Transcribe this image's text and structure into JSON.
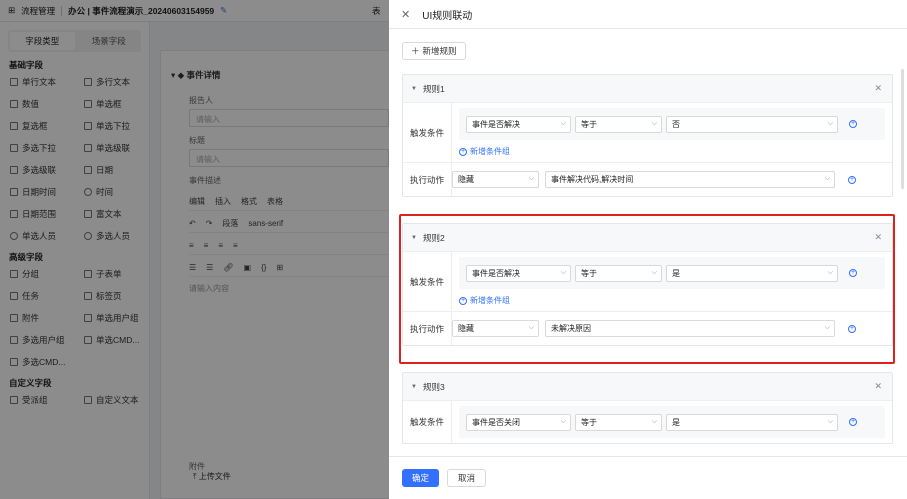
{
  "topbar": {
    "breadcrumb_root": "流程管理",
    "breadcrumb_current": "办公 | 事件流程演示_20240603154959",
    "right_label": "表"
  },
  "left_panel": {
    "tabs": [
      {
        "label": "字段类型"
      },
      {
        "label": "场景字段"
      }
    ],
    "sections": [
      {
        "title": "基础字段",
        "items": [
          "单行文本",
          "多行文本",
          "数值",
          "单选框",
          "复选框",
          "单选下拉",
          "多选下拉",
          "单选级联",
          "多选级联",
          "日期",
          "日期时间",
          "时间",
          "日期范围",
          "富文本",
          "单选人员",
          "多选人员"
        ]
      },
      {
        "title": "高级字段",
        "items": [
          "分组",
          "子表单",
          "任务",
          "标签页",
          "附件",
          "单选用户组",
          "多选用户组",
          "单选CMD...",
          "多选CMD..."
        ]
      },
      {
        "title": "自定义字段",
        "items": [
          "受派组",
          "自定义文本"
        ]
      }
    ]
  },
  "canvas": {
    "section_title": "事件详情",
    "reporter_label": "报告人",
    "reporter_placeholder": "请输入",
    "title_label": "标题",
    "title_placeholder": "请输入",
    "desc_label": "事件描述",
    "editor_menu": [
      "编辑",
      "插入",
      "格式",
      "表格"
    ],
    "editor_font_block": "段落",
    "editor_font_family": "sans-serif",
    "editor_placeholder": "请输入内容",
    "attachment_label": "附件",
    "upload_label": "上传文件"
  },
  "drawer": {
    "title": "UI规则联动",
    "add_rule_label": "新增规则",
    "trigger_label": "触发条件",
    "action_label": "执行动作",
    "add_group_label": "新增条件组",
    "rules": [
      {
        "name": "规则1",
        "cond_field": "事件是否解决",
        "cond_op": "等于",
        "cond_value": "否",
        "action": "隐藏",
        "action_target": "事件解决代码,解决时间"
      },
      {
        "name": "规则2",
        "cond_field": "事件是否解决",
        "cond_op": "等于",
        "cond_value": "是",
        "action": "隐藏",
        "action_target": "未解决原因"
      },
      {
        "name": "规则3",
        "cond_field": "事件是否关闭",
        "cond_op": "等于",
        "cond_value": "是"
      }
    ],
    "confirm_label": "确定",
    "cancel_label": "取消"
  }
}
